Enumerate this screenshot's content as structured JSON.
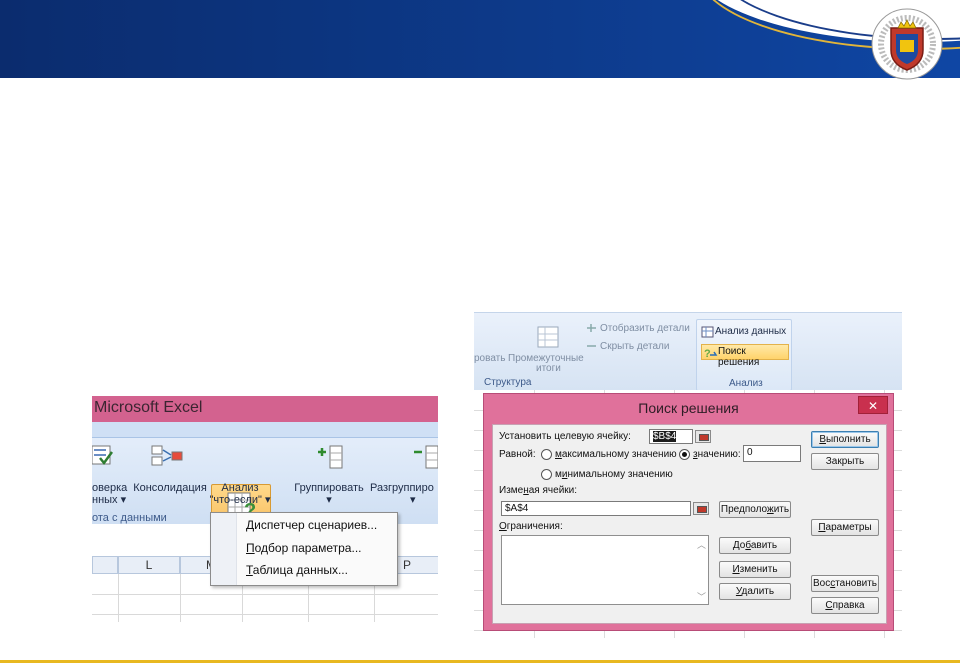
{
  "left_window": {
    "title": "Microsoft Excel",
    "ribbon": {
      "check_label_1": "оверка",
      "check_label_2": "нных ▾",
      "consolidation": "Консолидация",
      "analysis_1": "Анализ",
      "analysis_2": "\"что-если\" ▾",
      "group": "Группировать",
      "group_arrow": "▾",
      "ungroup": "Разгруппиро",
      "ungroup_arrow": "▾",
      "group_caption": "ота с данными"
    },
    "menu": [
      {
        "accel": "Д",
        "rest": "испетчер сценариев..."
      },
      {
        "accel": "П",
        "rest": "одбор параметра..."
      },
      {
        "accel": "Т",
        "rest": "аблица данных..."
      }
    ],
    "columns": [
      "L",
      "M",
      "P"
    ]
  },
  "right_ribbon": {
    "show_details": "Отобразить детали",
    "hide_details": "Скрыть детали",
    "group_partial": "ровать",
    "subtotals_1": "Промежуточные",
    "subtotals_2": "итоги",
    "structure_caption": "Структура",
    "data_analysis": "Анализ данных",
    "solver": "Поиск решения",
    "analysis_caption": "Анализ"
  },
  "dialog": {
    "title": "Поиск решения",
    "close": "✕",
    "target_label": "Установить целевую ячейку:",
    "target_value": "$B$4",
    "equal_label": "Равной:",
    "max_pre": "",
    "max_accel": "м",
    "max_rest": "аксимальному значению",
    "value_pre": "",
    "value_accel": "з",
    "value_rest": "начению:",
    "value_input": "0",
    "min_pre": "м",
    "min_accel": "и",
    "min_rest": "нимальному значению",
    "changing_pre": "Изме",
    "changing_accel": "н",
    "changing_rest": "ая ячейки:",
    "changing_value": "$A$4",
    "guess_pre": "Предполо",
    "guess_accel": "ж",
    "guess_rest": "ить",
    "constraints_accel": "О",
    "constraints_rest": "граничения:",
    "add_pre": "До",
    "add_accel": "б",
    "add_rest": "авить",
    "change_accel": "И",
    "change_rest": "зменить",
    "delete_accel": "У",
    "delete_rest": "далить",
    "run_accel": "В",
    "run_rest": "ыполнить",
    "close_btn": "Закрыть",
    "params_accel": "П",
    "params_rest": "араметры",
    "restore_pre": "Вос",
    "restore_accel": "с",
    "restore_rest": "тановить",
    "help_accel": "С",
    "help_rest": "правка"
  },
  "colors": {
    "header_blue": "#0d3a8a",
    "accent_gold": "#e8b820",
    "window_pink": "#e0719b"
  }
}
